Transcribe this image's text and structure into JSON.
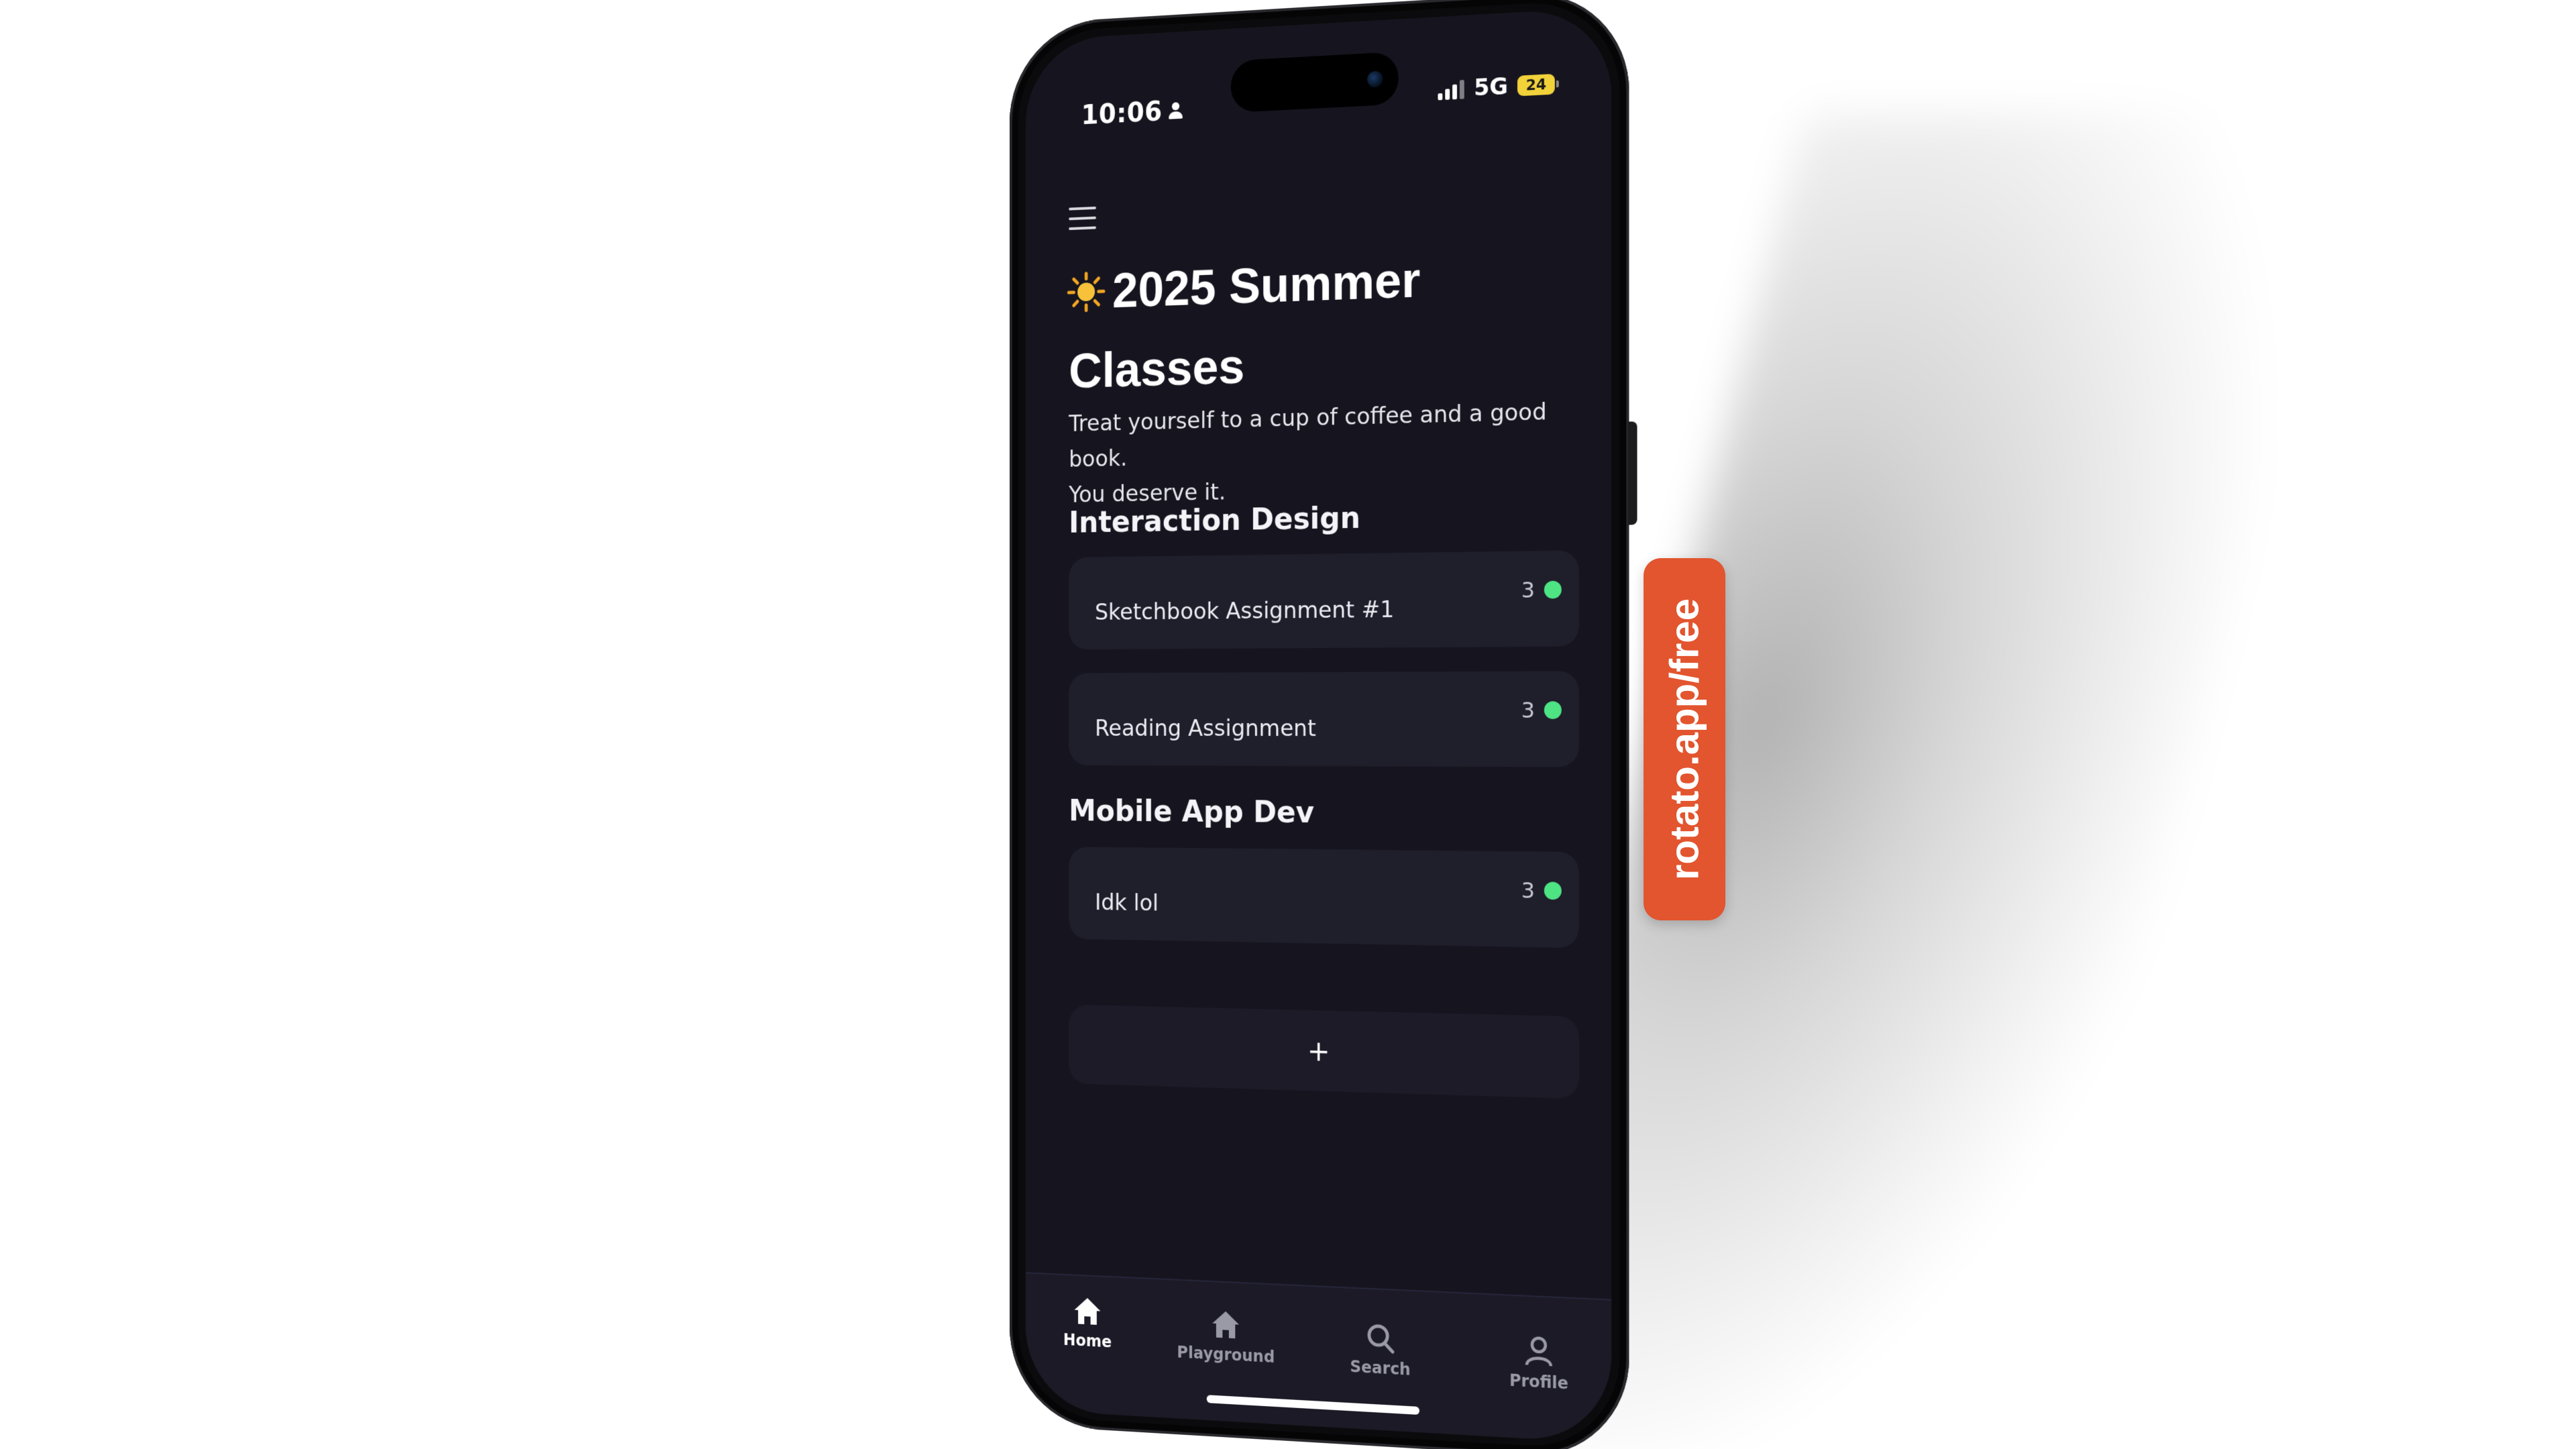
{
  "status_bar": {
    "time": "10:06",
    "network": "5G",
    "battery": "24"
  },
  "header": {
    "menu_icon": "hamburger-menu-icon",
    "title_emoji_icon": "sun-icon",
    "title_line1": "2025 Summer",
    "title_line2": "Classes",
    "subtitle_line1": "Treat yourself to a cup of coffee and a good book.",
    "subtitle_line2": "You deserve it."
  },
  "sections": [
    {
      "title": "Interaction Design",
      "items": [
        {
          "label": "Sketchbook Assignment #1",
          "count": "3",
          "status_color": "#4ee484"
        },
        {
          "label": "Reading Assignment",
          "count": "3",
          "status_color": "#4ee484"
        }
      ]
    },
    {
      "title": "Mobile App Dev",
      "items": [
        {
          "label": "Idk lol",
          "count": "3",
          "status_color": "#4ee484"
        }
      ]
    }
  ],
  "add_button": {
    "label": "+"
  },
  "tabbar": {
    "tabs": [
      {
        "label": "Home",
        "icon": "home-icon",
        "active": true
      },
      {
        "label": "Playground",
        "icon": "home-icon",
        "active": false
      },
      {
        "label": "Search",
        "icon": "search-icon",
        "active": false
      },
      {
        "label": "Profile",
        "icon": "profile-icon",
        "active": false
      }
    ]
  },
  "watermark": {
    "text": "rotato.app/free",
    "color": "#e2552f"
  },
  "colors": {
    "screen_background": "#16151f",
    "card_background": "#1f1e2b",
    "status_dot": "#4ee484",
    "battery": "#f1d23a"
  }
}
